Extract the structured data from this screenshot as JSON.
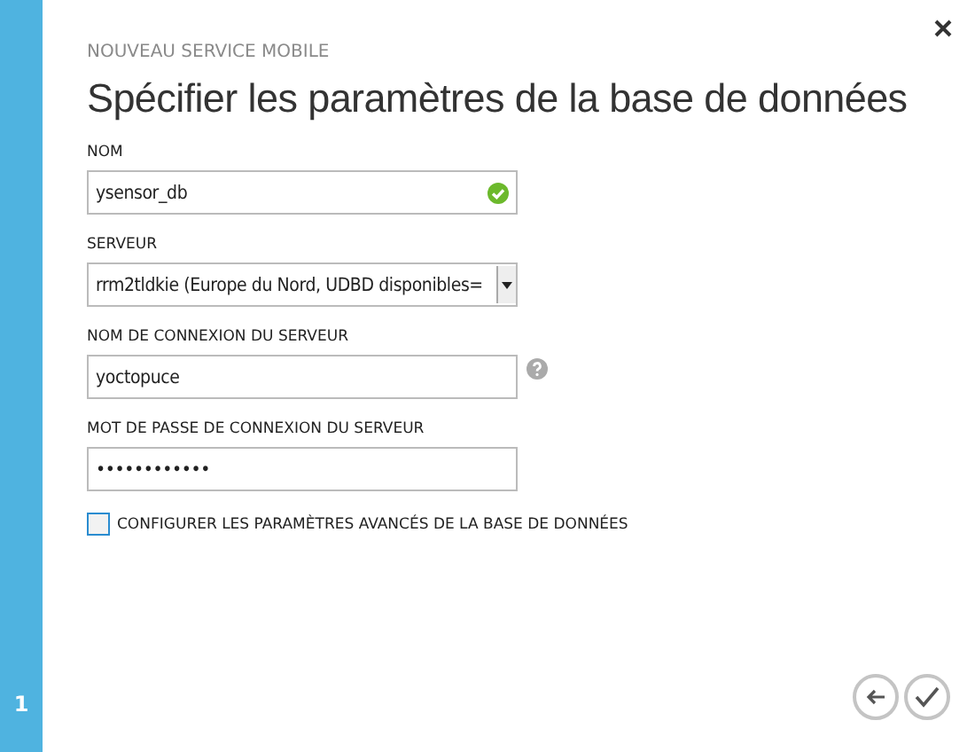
{
  "sidebar": {
    "step": "1"
  },
  "dialog": {
    "subtitle": "NOUVEAU SERVICE MOBILE",
    "title": "Spécifier les paramètres de la base de données"
  },
  "fields": [
    {
      "kind": "text",
      "label": "NOM",
      "value": "ysensor_db",
      "valid": true,
      "help": false
    },
    {
      "kind": "select",
      "label": "SERVEUR",
      "value": "rrm2tldkie (Europe du Nord, UDBD disponibles="
    },
    {
      "kind": "text",
      "label": "NOM DE CONNEXION DU SERVEUR",
      "value": "yoctopuce",
      "valid": false,
      "help": true
    },
    {
      "kind": "text",
      "label": "MOT DE PASSE DE CONNEXION DU SERVEUR",
      "value": "••••••••••••",
      "valid": false,
      "help": false
    }
  ],
  "advanced": {
    "label": "CONFIGURER LES PARAMÈTRES AVANCÉS DE LA BASE DE DONNÉES",
    "checked": false
  }
}
